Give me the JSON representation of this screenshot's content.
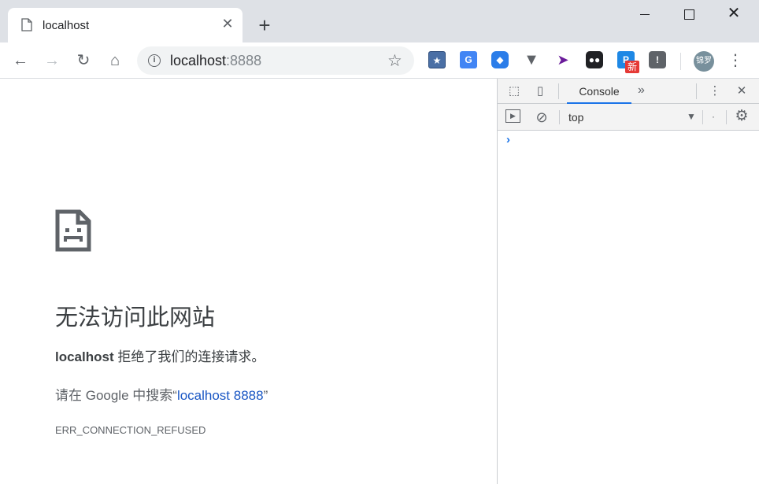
{
  "tab": {
    "title": "localhost",
    "close_glyph": "✕",
    "new_tab_glyph": "+"
  },
  "window": {
    "close_glyph": "✕"
  },
  "toolbar": {
    "back_glyph": "←",
    "forward_glyph": "→",
    "reload_glyph": "↻",
    "home_glyph": "⌂",
    "url_host": "localhost",
    "url_port": ":8888",
    "bookmark_glyph": "☆",
    "extensions": [
      {
        "name": "bookmark-manager",
        "glyph": "★"
      },
      {
        "name": "google-translate",
        "glyph": "G"
      },
      {
        "name": "blue-extension",
        "glyph": "◆"
      },
      {
        "name": "vue-devtools",
        "glyph": "▼"
      },
      {
        "name": "cursor-extension",
        "glyph": "➤"
      },
      {
        "name": "tampermonkey",
        "glyph": "●●"
      },
      {
        "name": "p-extension",
        "glyph": "P",
        "badge": "新"
      },
      {
        "name": "lightbulb-extension",
        "glyph": "!"
      }
    ],
    "avatar_text": "锦罗",
    "menu_glyph": "⋮"
  },
  "page": {
    "heading": "无法访问此网站",
    "host": "localhost",
    "refused_text": " 拒绝了我们的连接请求。",
    "search_prefix": "请在 Google 中搜索“",
    "search_link": "localhost 8888",
    "search_suffix": "”",
    "error_code": "ERR_CONNECTION_REFUSED"
  },
  "devtools": {
    "inspect_glyph": "⬚",
    "device_glyph": "▯",
    "console_tab": "Console",
    "more_tabs_glyph": "»",
    "menu_glyph": "⋮",
    "close_glyph": "✕",
    "sidebar_glyph": "▶",
    "clear_glyph": "⊘",
    "context": "top",
    "context_arrow": "▼",
    "filter_dot": "·",
    "settings_glyph": "⚙",
    "prompt_glyph": "›"
  },
  "colors": {
    "tabstrip": "#dee1e6",
    "link": "#1a57c4",
    "devtools_accent": "#1a73e8"
  }
}
